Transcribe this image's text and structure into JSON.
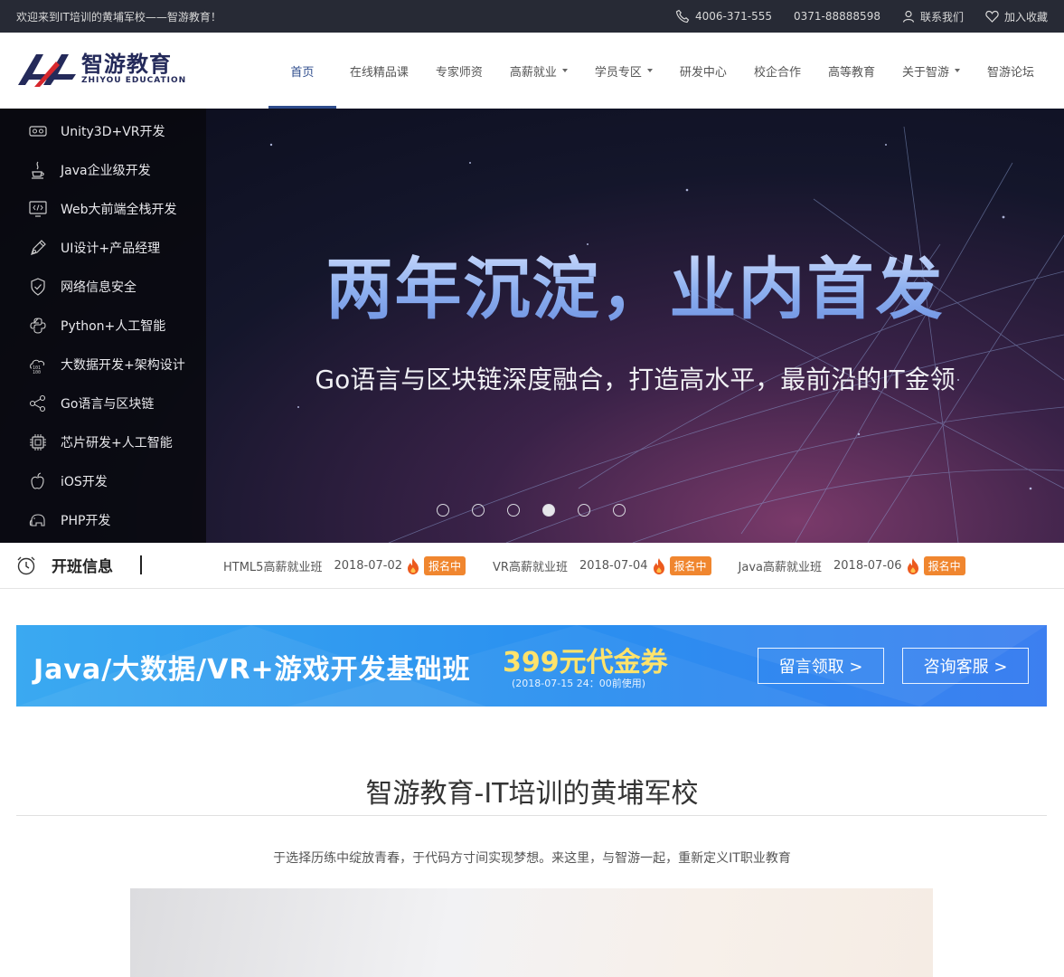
{
  "topbar": {
    "welcome": "欢迎来到IT培训的黄埔军校——智游教育！",
    "phone1": "4006-371-555",
    "phone2": "0371-88888598",
    "contact": "联系我们",
    "favorite": "加入收藏"
  },
  "logo": {
    "cn": "智游教育",
    "en": "ZHIYOU EDUCATION"
  },
  "nav": {
    "items": [
      {
        "label": "首页"
      },
      {
        "label": "在线精品课"
      },
      {
        "label": "专家师资"
      },
      {
        "label": "高薪就业"
      },
      {
        "label": "学员专区"
      },
      {
        "label": "研发中心"
      },
      {
        "label": "校企合作"
      },
      {
        "label": "高等教育"
      },
      {
        "label": "关于智游"
      },
      {
        "label": "智游论坛"
      }
    ],
    "active_index": 0
  },
  "sidebar": {
    "items": [
      {
        "label": "Unity3D+VR开发",
        "icon": "vr-headset-icon"
      },
      {
        "label": "Java企业级开发",
        "icon": "java-cup-icon"
      },
      {
        "label": "Web大前端全栈开发",
        "icon": "code-monitor-icon"
      },
      {
        "label": "UI设计+产品经理",
        "icon": "pen-icon"
      },
      {
        "label": "网络信息安全",
        "icon": "shield-check-icon"
      },
      {
        "label": "Python+人工智能",
        "icon": "python-icon"
      },
      {
        "label": "大数据开发+架构设计",
        "icon": "binary-data-icon"
      },
      {
        "label": "Go语言与区块链",
        "icon": "network-nodes-icon"
      },
      {
        "label": "芯片研发+人工智能",
        "icon": "chip-icon"
      },
      {
        "label": "iOS开发",
        "icon": "apple-icon"
      },
      {
        "label": "PHP开发",
        "icon": "elephant-icon"
      }
    ]
  },
  "banner": {
    "title": "两年沉淀，业内首发",
    "subtitle": "Go语言与区块链深度融合，打造高水平，最前沿的IT金领",
    "slide_count": 6,
    "active_slide": 4
  },
  "classes": {
    "heading": "开班信息",
    "items": [
      {
        "name": "HTML5高薪就业班",
        "date": "2018-07-02",
        "status": "报名中"
      },
      {
        "name": "VR高薪就业班",
        "date": "2018-07-04",
        "status": "报名中"
      },
      {
        "name": "Java高薪就业班",
        "date": "2018-07-06",
        "status": "报名中"
      }
    ]
  },
  "promo": {
    "title": "Java/大数据/VR+游戏开发基础班",
    "amount": "399元代金券",
    "note": "(2018-07-15  24：00前使用)",
    "btn_message": "留言领取 >",
    "btn_consult": "咨询客服 >"
  },
  "intro": {
    "title": "智游教育-IT培训的黄埔军校",
    "desc": "于选择历练中绽放青春，于代码方寸间实现梦想。来这里，与智游一起，重新定义IT职业教育"
  },
  "colors": {
    "topbar_bg": "#272a35",
    "nav_active": "#2e4c8c",
    "badge": "#f0862f",
    "promo_bg": "#2a8ff0",
    "promo_accent": "#ffe36b"
  }
}
